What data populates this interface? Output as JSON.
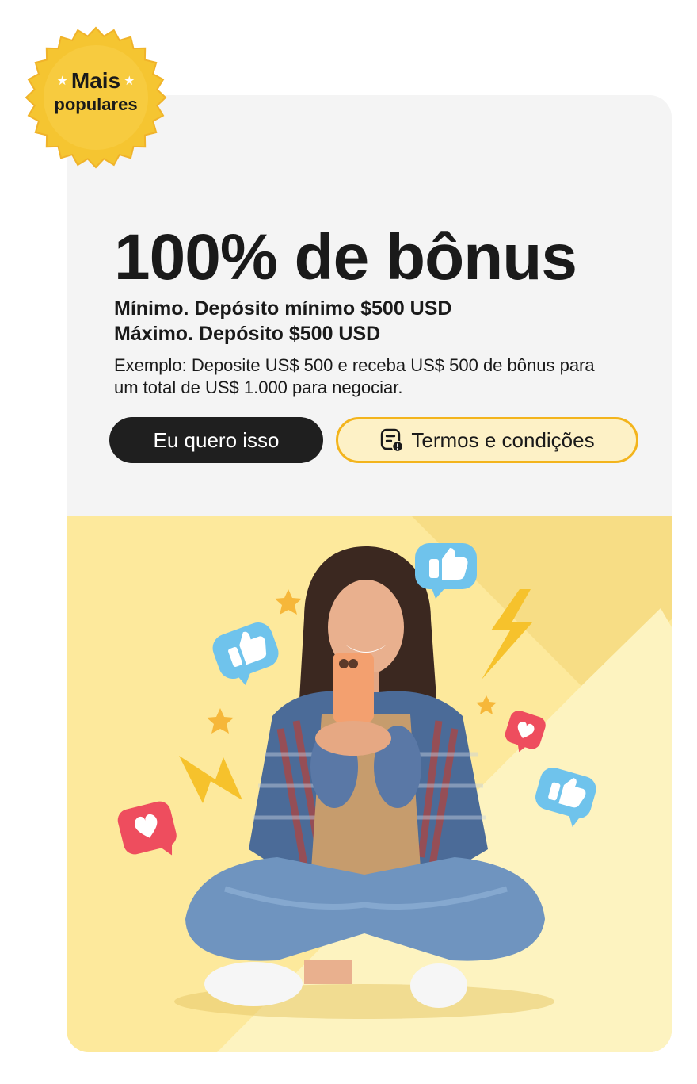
{
  "badge": {
    "line1": "Mais",
    "line2": "populares",
    "star_glyph": "★"
  },
  "offer": {
    "title": "100% de bônus",
    "minimum": "Mínimo. Depósito mínimo $500 USD",
    "maximum": "Máximo. Depósito $500 USD",
    "example": "Exemplo: Deposite US$ 500 e receba US$ 500 de bônus para um total de US$ 1.000 para negociar."
  },
  "buttons": {
    "primary_label": "Eu quero isso",
    "terms_label": "Termos e condições",
    "terms_icon": "document-info-icon"
  },
  "colors": {
    "card_background": "#f4f4f4",
    "primary_button": "#1f1f1f",
    "accent_yellow": "#f3b41c",
    "terms_button_fill": "#fdf1c6",
    "hero_background": "#fde99c",
    "badge_gold": "#f5c531"
  },
  "hero_image": {
    "icons": [
      "thumbs-up-icon",
      "heart-icon",
      "lightning-icon",
      "star-icon"
    ]
  }
}
